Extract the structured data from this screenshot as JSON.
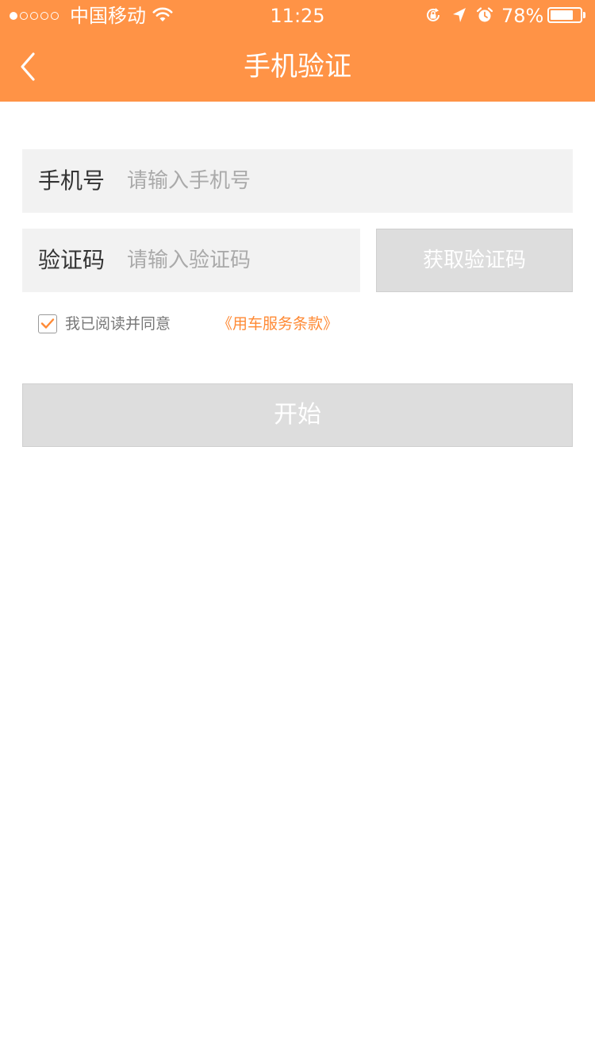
{
  "status_bar": {
    "carrier": "中国移动",
    "time": "11:25",
    "battery_percent_text": "78%",
    "battery_level": 0.78,
    "signal_strength": 1,
    "signal_total": 5
  },
  "nav": {
    "title": "手机验证"
  },
  "phone_field": {
    "label": "手机号",
    "placeholder": "请输入手机号"
  },
  "code_field": {
    "label": "验证码",
    "placeholder": "请输入验证码"
  },
  "get_code_button": {
    "label": "获取验证码"
  },
  "agreement": {
    "checked": true,
    "text": "我已阅读并同意",
    "link_text": "《用车服务条款》"
  },
  "start_button": {
    "label": "开始"
  },
  "colors": {
    "accent": "#FF9346",
    "link": "#FF8A35",
    "disabled_button": "#DDDDDD",
    "field_background": "#F2F2F2"
  },
  "icons": [
    "back-chevron-icon",
    "wifi-icon",
    "rotation-lock-icon",
    "location-arrow-icon",
    "alarm-icon",
    "battery-icon",
    "checkmark-icon"
  ]
}
